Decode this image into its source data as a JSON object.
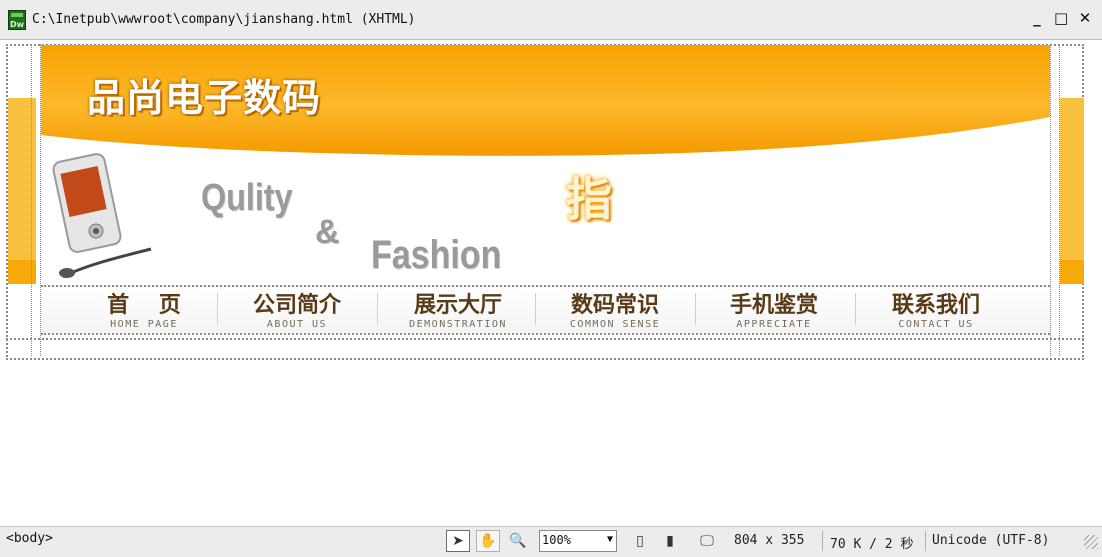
{
  "window": {
    "title": "C:\\Inetpub\\wwwroot\\company\\jianshang.html (XHTML)",
    "app_icon": "Dw",
    "controls": {
      "minimize": "_",
      "maximize": "□",
      "close": "✕"
    }
  },
  "banner": {
    "site_title": "品尚电子数码",
    "slogan_1": "Qulity",
    "slogan_amp": "&",
    "slogan_2": "Fashion",
    "glyph": "指"
  },
  "nav": {
    "items": [
      {
        "zh": "首　 页",
        "en": "HOME PAGE"
      },
      {
        "zh": "公司简介",
        "en": "ABOUT US"
      },
      {
        "zh": "展示大厅",
        "en": "DEMONSTRATION"
      },
      {
        "zh": "数码常识",
        "en": "COMMON SENSE"
      },
      {
        "zh": "手机鉴赏",
        "en": "APPRECIATE"
      },
      {
        "zh": "联系我们",
        "en": "CONTACT US"
      }
    ]
  },
  "statusbar": {
    "tag_path": "<body>",
    "zoom": "100%",
    "window_size": "804 x 355",
    "download": "70 K / 2 秒",
    "encoding": "Unicode (UTF-8)"
  },
  "colors": {
    "orange": "#f7a90a",
    "nav_text": "#5a3a16"
  }
}
